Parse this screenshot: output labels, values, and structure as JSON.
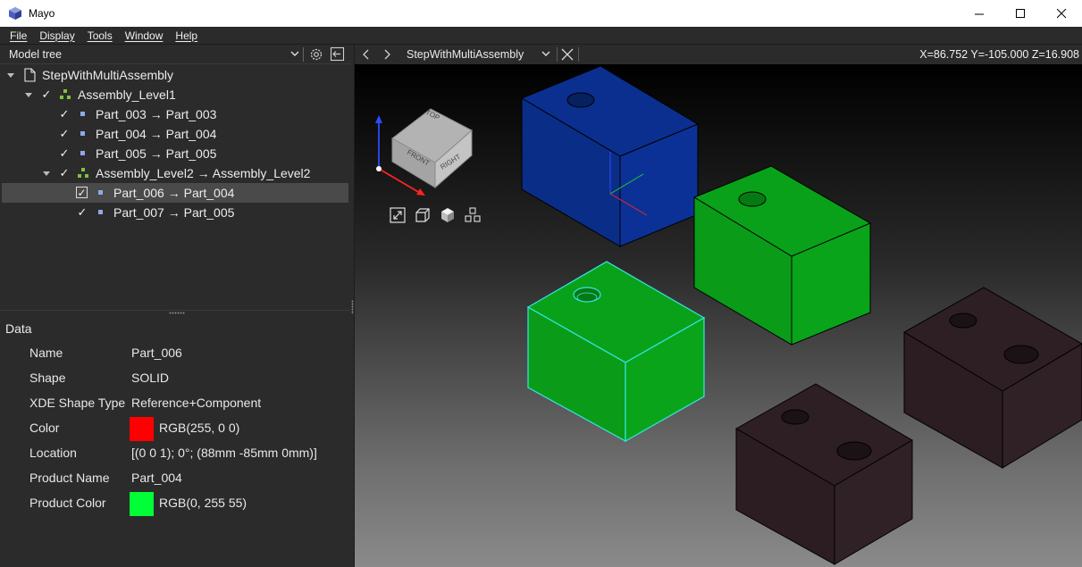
{
  "window": {
    "title": "Mayo",
    "minimize_glyph": "—",
    "maximize_glyph": "☐",
    "close_glyph": "✕"
  },
  "menu": [
    {
      "label": "File"
    },
    {
      "label": "Display"
    },
    {
      "label": "Tools"
    },
    {
      "label": "Window"
    },
    {
      "label": "Help"
    }
  ],
  "left_panel": {
    "header": {
      "title": "Model tree"
    },
    "tree": [
      {
        "label": "StepWithMultiAssembly",
        "icon": "document-icon",
        "expanded": true
      },
      {
        "label": "Assembly_Level1",
        "icon": "assembly-icon",
        "checked": true,
        "expanded": true
      },
      {
        "label": "Part_003 → Part_003",
        "icon": "part-icon",
        "checked": true
      },
      {
        "label": "Part_004 → Part_004",
        "icon": "part-icon",
        "checked": true
      },
      {
        "label": "Part_005 → Part_005",
        "icon": "part-icon",
        "checked": true
      },
      {
        "label": "Assembly_Level2 → Assembly_Level2",
        "icon": "assembly-icon",
        "checked": true,
        "expanded": true
      },
      {
        "label": "Part_006 → Part_004",
        "icon": "part-icon",
        "checked": true,
        "selected": true
      },
      {
        "label": "Part_007 → Part_005",
        "icon": "part-icon",
        "checked": true
      }
    ],
    "data": {
      "title": "Data",
      "properties": [
        {
          "key": "Name",
          "value": "Part_006"
        },
        {
          "key": "Shape",
          "value": "SOLID"
        },
        {
          "key": "XDE Shape Type",
          "value": "Reference+Component"
        },
        {
          "key": "Color",
          "value": "RGB(255, 0 0)",
          "swatch": "#ff0000"
        },
        {
          "key": "Location",
          "value": "[(0 0 1); 0°; (88mm -85mm 0mm)]"
        },
        {
          "key": "Product Name",
          "value": "Part_004"
        },
        {
          "key": "Product Color",
          "value": "RGB(0, 255 55)",
          "swatch": "#00ff37"
        }
      ]
    }
  },
  "viewer": {
    "document_title": "StepWithMultiAssembly",
    "coordinates": "X=86.752  Y=-105.000  Z=16.908",
    "view_cube": {
      "top": "TOP",
      "front": "FRONT",
      "right": "RIGHT"
    },
    "colors": {
      "blue_part": "#0b2f8f",
      "green_part": "#0aa11a",
      "dark_part": "#2e1f24",
      "selection_highlight": "#33e6e6"
    }
  }
}
